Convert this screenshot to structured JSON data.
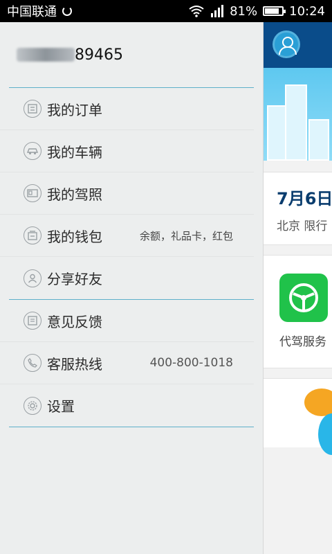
{
  "status_bar": {
    "carrier": "中国联通",
    "battery_percent": "81%",
    "battery_level": 0.81,
    "time": "10:24"
  },
  "drawer": {
    "user_number": "89465",
    "menu": [
      {
        "label": "我的订单",
        "extra": "",
        "icon": "order-icon"
      },
      {
        "label": "我的车辆",
        "extra": "",
        "icon": "car-icon"
      },
      {
        "label": "我的驾照",
        "extra": "",
        "icon": "license-icon"
      },
      {
        "label": "我的钱包",
        "extra": "余额，礼品卡，红包",
        "icon": "wallet-icon"
      },
      {
        "label": "分享好友",
        "extra": "",
        "icon": "user-share-icon"
      },
      {
        "label": "意见反馈",
        "extra": "",
        "icon": "feedback-icon"
      },
      {
        "label": "客服热线",
        "extra": "400-800-1018",
        "icon": "phone-icon"
      },
      {
        "label": "设置",
        "extra": "",
        "icon": "gear-icon"
      }
    ]
  },
  "background": {
    "date": "7月6日",
    "city_line": "北京 限行",
    "service_label": "代驾服务"
  },
  "colors": {
    "drawer_bg": "#eceeee",
    "divider": "#5db0c9",
    "header_blue": "#0a4c8a",
    "green": "#20c24a"
  }
}
